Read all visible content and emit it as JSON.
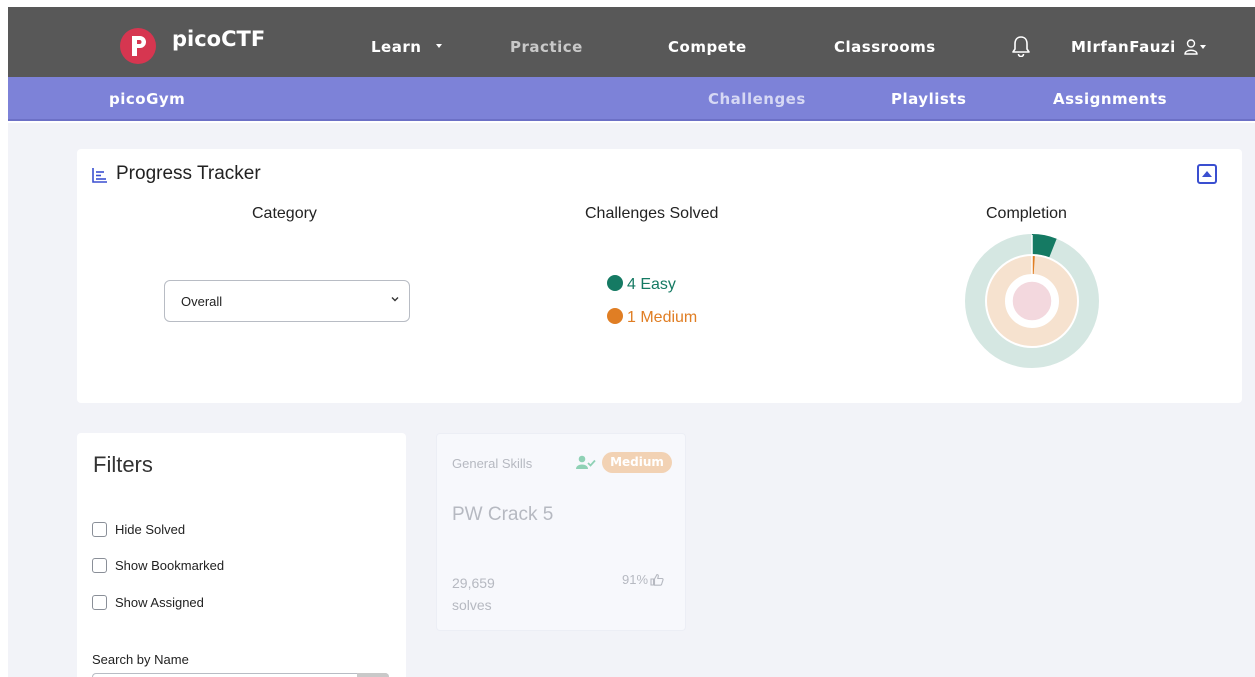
{
  "topnav": {
    "brand": "picoCTF",
    "learn": "Learn",
    "practice": "Practice",
    "compete": "Compete",
    "classrooms": "Classrooms",
    "username": "MIrfanFauzi"
  },
  "subnav": {
    "title": "picoGym",
    "challenges": "Challenges",
    "playlists": "Playlists",
    "assignments": "Assignments"
  },
  "tracker": {
    "title": "Progress Tracker",
    "category_header": "Category",
    "solved_header": "Challenges Solved",
    "completion_header": "Completion",
    "category_selected": "Overall",
    "easy": "4 Easy",
    "medium": "1 Medium",
    "completion": {
      "easy_fraction": 0.06,
      "medium_fraction": 0.01,
      "hard_fraction": 0.0
    }
  },
  "filters": {
    "title": "Filters",
    "hide_solved": "Hide Solved",
    "show_bookmarked": "Show Bookmarked",
    "show_assigned": "Show Assigned",
    "search_label": "Search by Name"
  },
  "challenge": {
    "category": "General Skills",
    "difficulty": "Medium",
    "name": "PW Crack 5",
    "solves_count": "29,659",
    "solves_label": "solves",
    "rating": "91%"
  },
  "colors": {
    "topbar": "#585858",
    "subbar": "#7d82d8",
    "easy": "#157a63",
    "medium": "#e07e24",
    "hard": "#d63650"
  }
}
